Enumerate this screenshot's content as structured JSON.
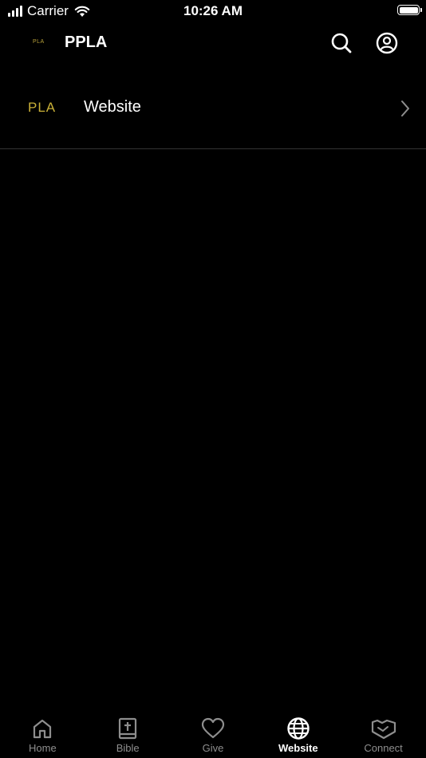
{
  "status_bar": {
    "carrier": "Carrier",
    "time": "10:26 AM"
  },
  "header": {
    "logo_text": "PLA",
    "title": "PPLA"
  },
  "list": {
    "items": [
      {
        "logo_text": "PLA",
        "label": "Website"
      }
    ]
  },
  "tabs": [
    {
      "label": "Home",
      "icon": "home-icon",
      "active": false
    },
    {
      "label": "Bible",
      "icon": "bible-icon",
      "active": false
    },
    {
      "label": "Give",
      "icon": "heart-icon",
      "active": false
    },
    {
      "label": "Website",
      "icon": "globe-icon",
      "active": true
    },
    {
      "label": "Connect",
      "icon": "handshake-icon",
      "active": false
    }
  ],
  "colors": {
    "background": "#000000",
    "inactive_tab": "#8e8e8e",
    "active_tab": "#ffffff",
    "logo_gold": "#c9b037"
  }
}
